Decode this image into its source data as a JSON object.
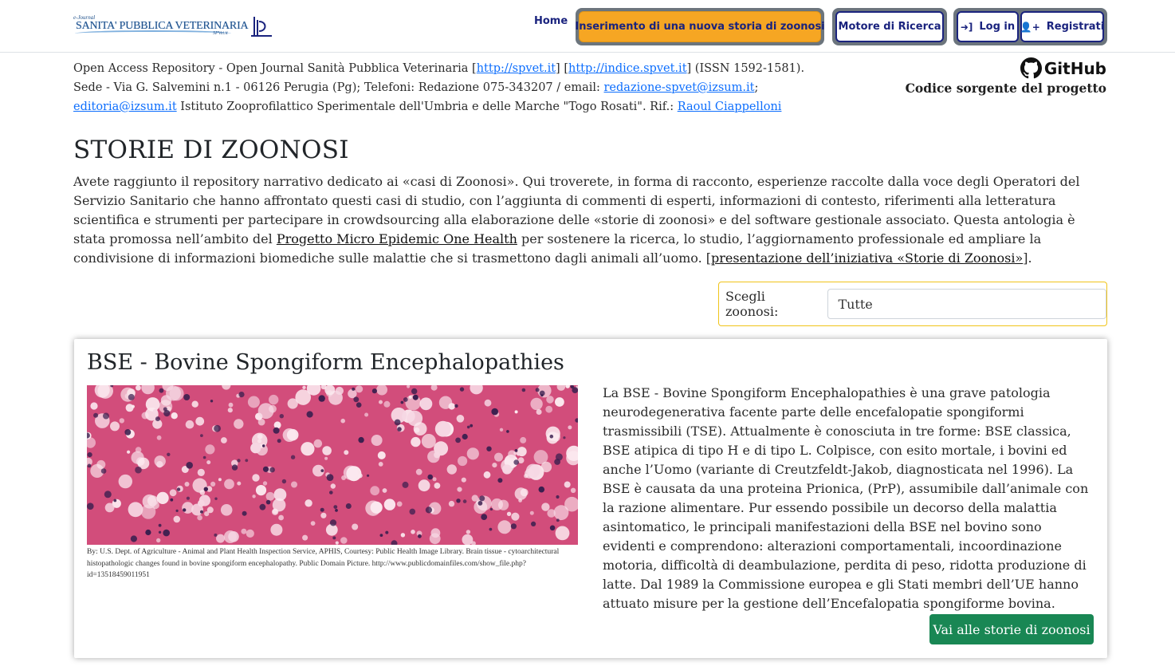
{
  "brand": {
    "ejournal": "e-Journal",
    "name": "SANITA' PUBBLICA VETERINARIA",
    "site": "SPVet.it"
  },
  "nav": {
    "home": "Home",
    "new_story": "Inserimento di una nuova storia di zoonosi",
    "search_engine": "Motore di Ricerca",
    "login": "Log in",
    "register": "Registrati",
    "accent": "#f6a623",
    "nav_color": "#1a237e"
  },
  "info": {
    "t1": "Open Access Repository - Open Journal Sanità Pubblica Veterinaria [",
    "link1": "http://spvet.it",
    "t2": "] [",
    "link2": "http://indice.spvet.it",
    "t3": "] (ISSN 1592-1581). Sede - Via G. Salvemini n.1 - 06126 Perugia (Pg); Telefoni: Redazione 075-343207 / email: ",
    "email1": "redazione-spvet@izsum.it",
    "t4": "; ",
    "email2": "editoria@izsum.it",
    "t5": " Istituto Zooprofilattico Sperimentale dell'Umbria e delle Marche \"Togo Rosati\". Rif.: ",
    "ref": "Raoul Ciappelloni"
  },
  "github": {
    "logo_text": "GitHub",
    "subtitle": "Codice sorgente del progetto"
  },
  "page_title": "STORIE DI ZOONOSI",
  "intro": {
    "t1": "Avete raggiunto il repository narrativo dedicato ai «casi di Zoonosi». Qui troverete, in forma di racconto, esperienze raccolte dalla voce degli Operatori del Servizio Sanitario che hanno affrontato questi casi di studio, con l’aggiunta di commenti di esperti, informazioni di contesto, riferimenti alla letteratura scientifica e strumenti per partecipare in crowdsourcing alla elaborazione delle «storie di zoonosi» e del software gestionale associato. Questa antologia è stata promossa nell’ambito del ",
    "link1": "Progetto Micro Epidemic One Health",
    "t2": " per sostenere la ricerca, lo studio, l’aggiornamento professionale ed ampliare la condivisione di informazioni biomediche sulle malattie che si trasmettono dagli animali all’uomo. [",
    "link2": "presentazione dell’iniziativa «Storie di Zoonosi»",
    "t3": "]."
  },
  "filter": {
    "label": "Scegli zoonosi:",
    "value": "Tutte"
  },
  "card": {
    "title": "BSE - Bovine Spongiform Encephalopathies",
    "caption": "By: U.S. Dept. of Agriculture - Animal and Plant Health Inspection Service, APHIS, Courtesy: Public Health Image Library. Brain tissue - cytoarchitectural histopathologic changes found in bovine spongiform encephalopathy. Public Domain Picture. http://www.publicdomainfiles.com/show_file.php?id=13518459011951",
    "text": "La BSE - Bovine Spongiform Encephalopathies è una grave patologia neurodegenerativa facente parte delle encefalopatie spongiformi trasmissibili (TSE). Attualmente è conosciuta in tre forme: BSE classica, BSE atipica di tipo H e di tipo L. Colpisce, con esito mortale, i bovini ed anche l’Uomo (variante di Creutzfeldt-Jakob, diagnosticata nel 1996). La BSE è causata da una proteina Prionica, (PrP), assumibile dall’animale con la razione alimentare. Pur essendo possibile un decorso della malattia asintomatico, le principali manifestazioni della BSE nel bovino sono evidenti e comprendono: alterazioni comportamentali, incoordinazione motoria, difficoltà di deambulazione, perdita di peso, ridotta produzione di latte. Dal 1989 la Commissione europea e gli Stati membri dell’UE hanno attuato misure per la gestione dell’Encefalopatia spongiforme bovina.",
    "button": "Vai alle storie di zoonosi",
    "button_color": "#198754",
    "image_icon": "histology-micrograph-image"
  }
}
